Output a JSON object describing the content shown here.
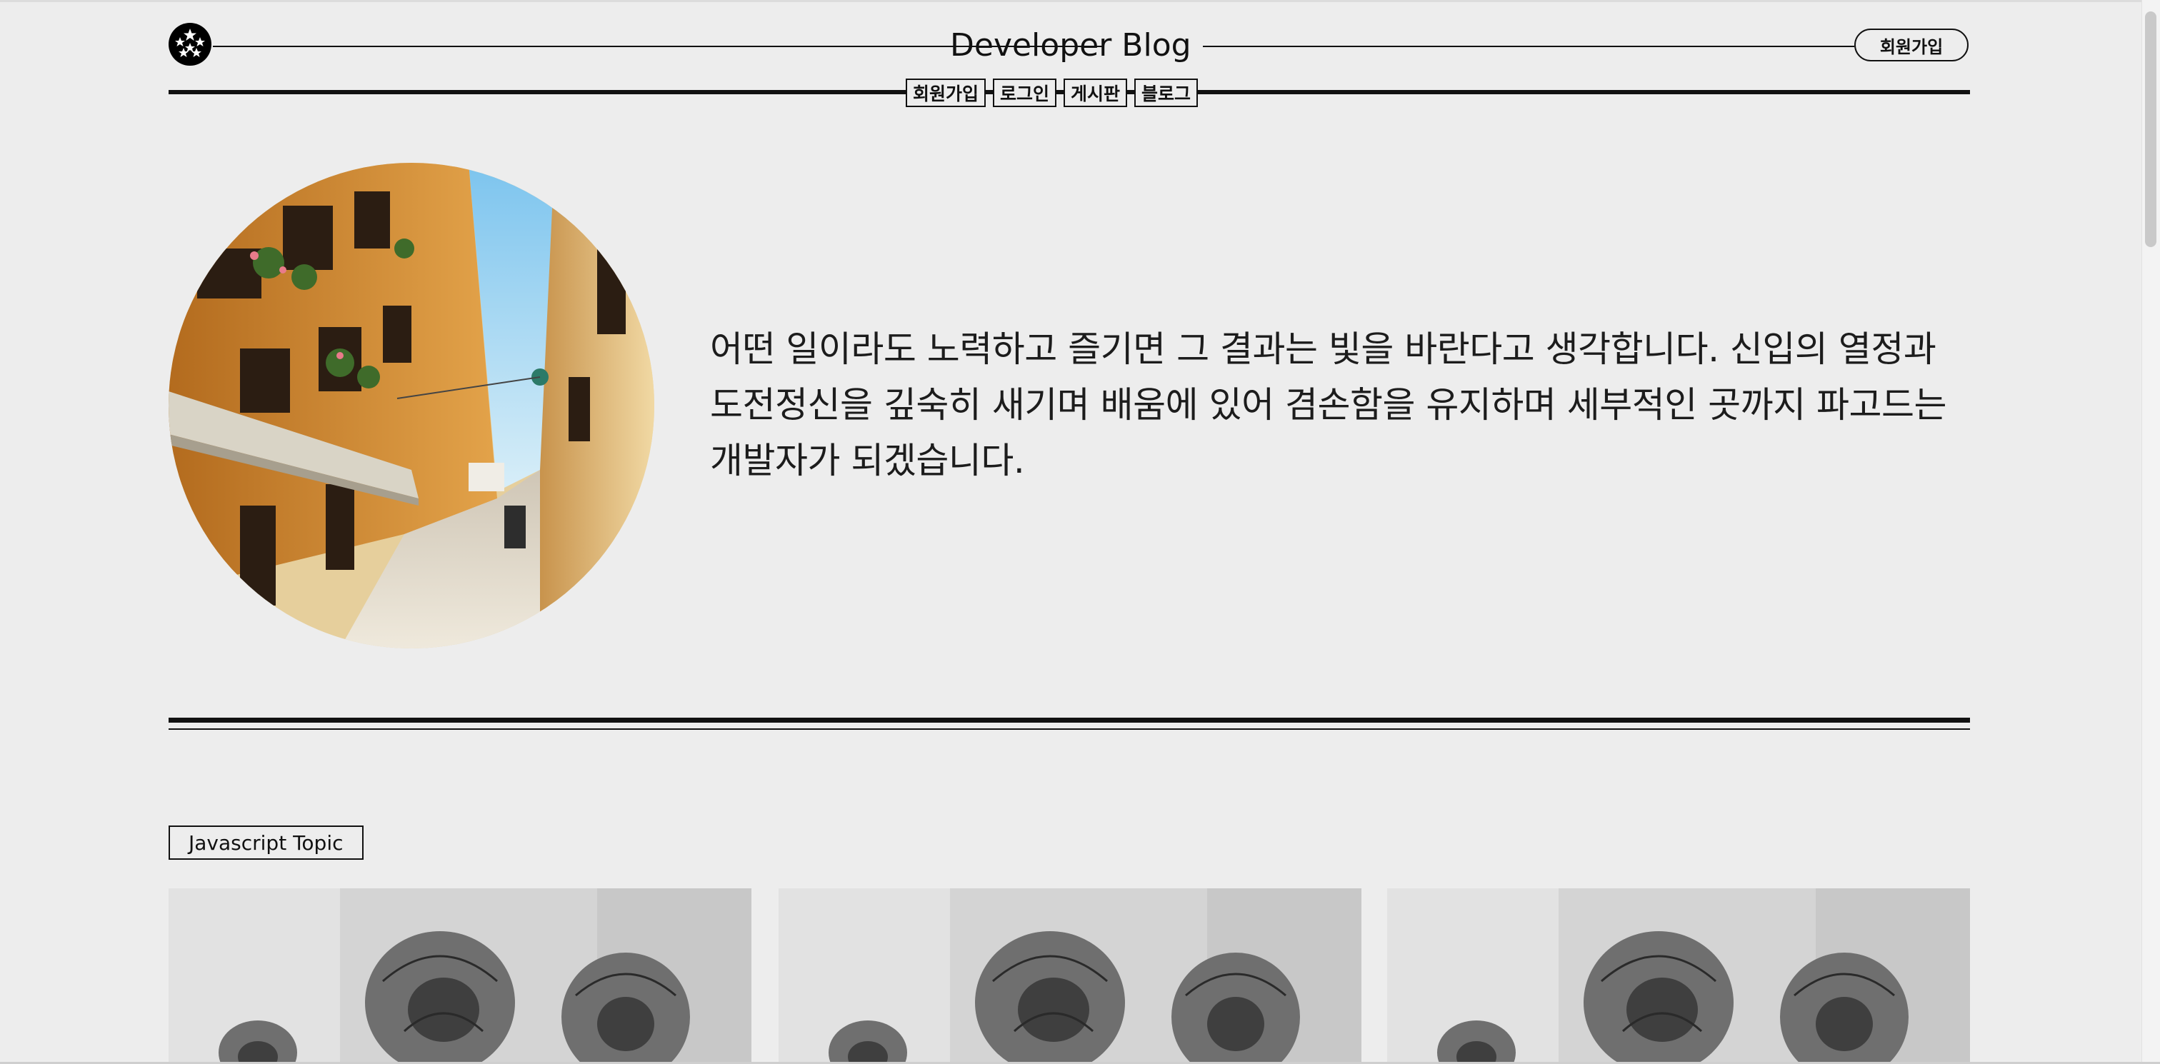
{
  "header": {
    "title": "Developer Blog",
    "signup_label": "회원가입",
    "logo_icon": "stars-logo-icon"
  },
  "nav": {
    "items": [
      "회원가입",
      "로그인",
      "게시판",
      "블로그"
    ]
  },
  "hero": {
    "image": "alley-street-photo",
    "text": "어떤 일이라도 노력하고 즐기면 그 결과는 빛을 바란다고 생각합니다. 신입의 열정과 도전정신을 깊숙히 새기며 배움에 있어 겸손함을 유지하며 세부적인 곳까지 파고드는 개발자가 되겠습니다."
  },
  "topic": {
    "label": "Javascript Topic",
    "cards": [
      {
        "image": "roses-grayscale-photo"
      },
      {
        "image": "roses-grayscale-photo"
      },
      {
        "image": "roses-grayscale-photo"
      }
    ]
  },
  "colors": {
    "background": "#ededed",
    "ink": "#111111"
  }
}
